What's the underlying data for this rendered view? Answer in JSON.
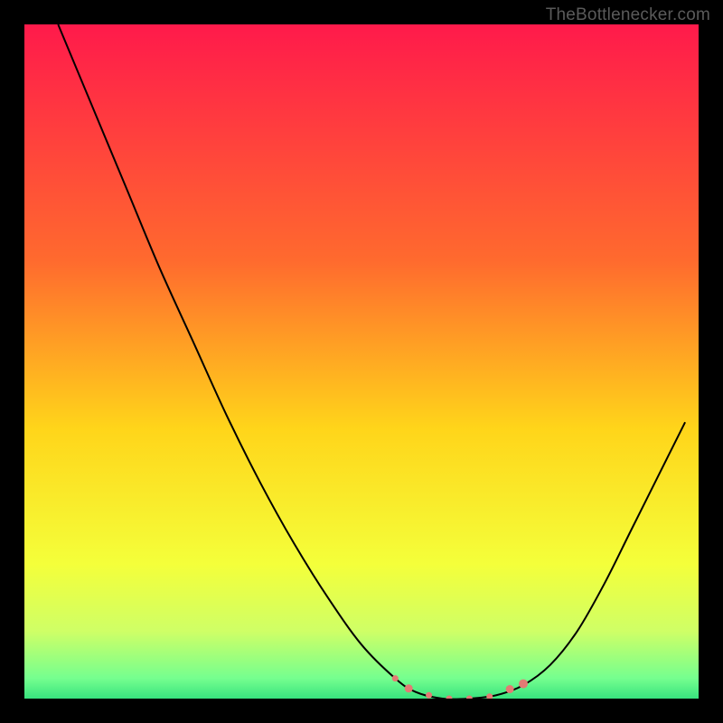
{
  "watermark": "TheBottlenecker.com",
  "chart_data": {
    "type": "line",
    "title": "",
    "xlabel": "",
    "ylabel": "",
    "xlim": [
      0,
      100
    ],
    "ylim": [
      0,
      100
    ],
    "background_gradient": {
      "stops": [
        {
          "offset": 0,
          "color": "#ff1a4b"
        },
        {
          "offset": 35,
          "color": "#ff6a2e"
        },
        {
          "offset": 60,
          "color": "#ffd51a"
        },
        {
          "offset": 80,
          "color": "#f4ff3a"
        },
        {
          "offset": 90,
          "color": "#cfff66"
        },
        {
          "offset": 97,
          "color": "#75ff8f"
        },
        {
          "offset": 100,
          "color": "#38e27e"
        }
      ]
    },
    "series": [
      {
        "name": "bottleneck-curve",
        "type": "line",
        "color": "#000000",
        "points": [
          {
            "x": 5,
            "y": 100
          },
          {
            "x": 10,
            "y": 88
          },
          {
            "x": 15,
            "y": 76
          },
          {
            "x": 20,
            "y": 64
          },
          {
            "x": 25,
            "y": 53
          },
          {
            "x": 30,
            "y": 42
          },
          {
            "x": 35,
            "y": 32
          },
          {
            "x": 40,
            "y": 23
          },
          {
            "x": 45,
            "y": 15
          },
          {
            "x": 50,
            "y": 8
          },
          {
            "x": 55,
            "y": 3
          },
          {
            "x": 58,
            "y": 1
          },
          {
            "x": 62,
            "y": 0
          },
          {
            "x": 66,
            "y": 0
          },
          {
            "x": 70,
            "y": 0.5
          },
          {
            "x": 74,
            "y": 2
          },
          {
            "x": 78,
            "y": 5
          },
          {
            "x": 82,
            "y": 10
          },
          {
            "x": 86,
            "y": 17
          },
          {
            "x": 90,
            "y": 25
          },
          {
            "x": 94,
            "y": 33
          },
          {
            "x": 98,
            "y": 41
          }
        ]
      },
      {
        "name": "highlight-markers",
        "type": "scatter",
        "color": "#e47a74",
        "points": [
          {
            "x": 55,
            "y": 3,
            "r": 3.5
          },
          {
            "x": 57,
            "y": 1.5,
            "r": 4.5
          },
          {
            "x": 60,
            "y": 0.5,
            "r": 3.5
          },
          {
            "x": 63,
            "y": 0,
            "r": 3.5
          },
          {
            "x": 66,
            "y": 0,
            "r": 3.5
          },
          {
            "x": 69,
            "y": 0.3,
            "r": 3.5
          },
          {
            "x": 72,
            "y": 1.4,
            "r": 4.5
          },
          {
            "x": 74,
            "y": 2.2,
            "r": 5
          }
        ]
      }
    ]
  }
}
